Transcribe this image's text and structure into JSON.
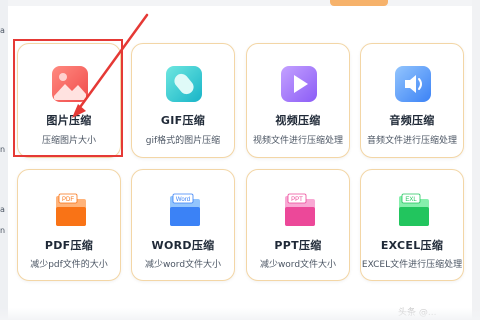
{
  "left_gutter": {
    "frag1": "a",
    "frag2": "n",
    "frag3": "a",
    "frag4": "n"
  },
  "cards": [
    {
      "title": "图片压缩",
      "subtitle": "压缩图片大小",
      "icon": "image-icon",
      "color": "#f15a5a"
    },
    {
      "title": "GIF压缩",
      "subtitle": "gif格式的图片压缩",
      "icon": "gif-icon",
      "color": "#2fc3d3"
    },
    {
      "title": "视频压缩",
      "subtitle": "视频文件进行压缩处理",
      "icon": "play-icon",
      "color": "#8b5cf6"
    },
    {
      "title": "音频压缩",
      "subtitle": "音频文件进行压缩处理",
      "icon": "speaker-icon",
      "color": "#3b82f6"
    },
    {
      "title": "PDF压缩",
      "subtitle": "减少pdf文件的大小",
      "icon": "pdf-file-icon",
      "color": "#f97316",
      "badge": "PDF"
    },
    {
      "title": "WORD压缩",
      "subtitle": "减少word文件大小",
      "icon": "word-file-icon",
      "color": "#3b82f6",
      "badge": "Word"
    },
    {
      "title": "PPT压缩",
      "subtitle": "减少word文件大小",
      "icon": "ppt-file-icon",
      "color": "#ec4899",
      "badge": "PPT"
    },
    {
      "title": "EXCEL压缩",
      "subtitle": "EXCEL文件进行压缩处理",
      "icon": "excel-file-icon",
      "color": "#22c55e",
      "badge": "EXL"
    }
  ],
  "highlight_color": "#e53935",
  "watermark": "头条 @..."
}
